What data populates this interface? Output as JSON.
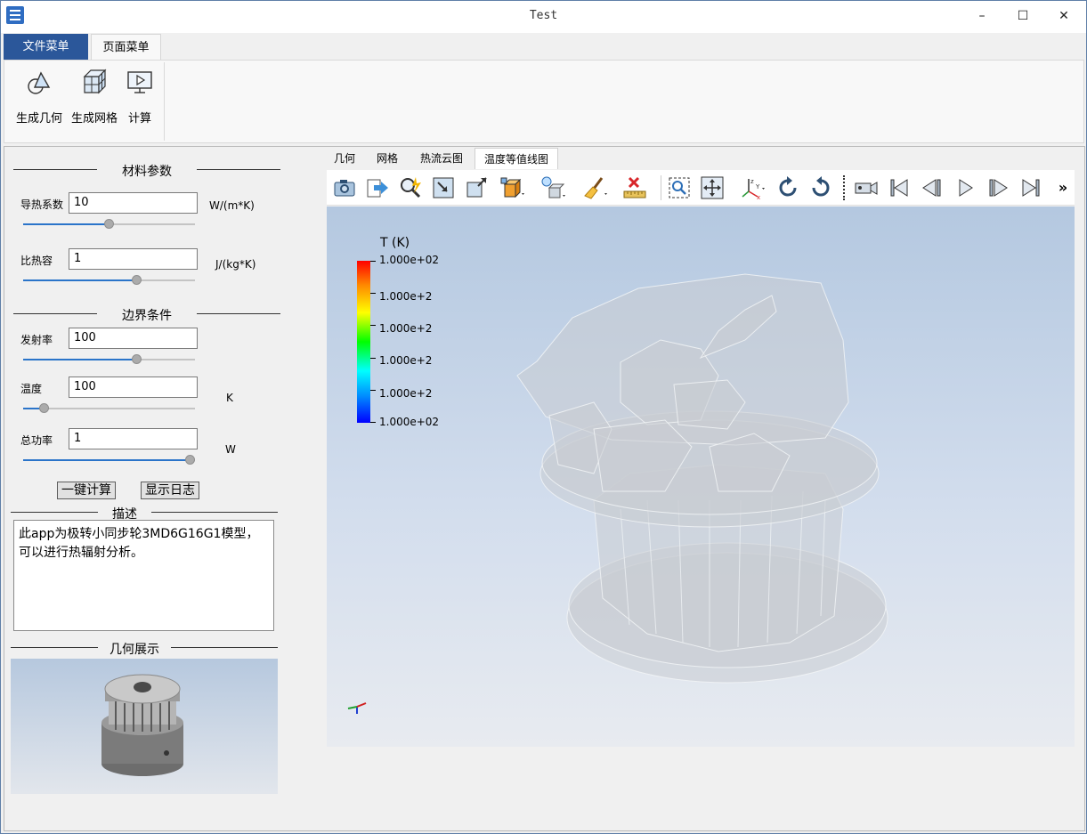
{
  "window": {
    "title": "Test",
    "minimize": "–",
    "maximize": "☐",
    "close": "✕"
  },
  "ribbon": {
    "tabs": [
      {
        "label": "文件菜单"
      },
      {
        "label": "页面菜单"
      }
    ],
    "buttons": [
      {
        "label": "生成几何"
      },
      {
        "label": "生成网格"
      },
      {
        "label": "计算"
      }
    ]
  },
  "panel": {
    "material_title": "材料参数",
    "boundary_title": "边界条件",
    "params": [
      {
        "label": "导热系数",
        "value": "10",
        "unit": "W/(m*K)",
        "slider": 0.5
      },
      {
        "label": "比热容",
        "value": "1",
        "unit": "J/(kg*K)",
        "slider": 0.67
      },
      {
        "label": "发射率",
        "value": "100",
        "unit": "",
        "slider": 0.67
      },
      {
        "label": "温度",
        "value": "100",
        "unit": "K",
        "slider": 0.1
      },
      {
        "label": "总功率",
        "value": "1",
        "unit": "W",
        "slider": 1.0
      }
    ],
    "calc_button": "一键计算",
    "log_button": "显示日志",
    "desc_title": "描述",
    "description": "此app为极转小同步轮3MD6G16G1模型，可以进行热辐射分析。",
    "geometry_title": "几何展示"
  },
  "viewer": {
    "tabs": [
      {
        "label": "几何"
      },
      {
        "label": "网格"
      },
      {
        "label": "热流云图"
      },
      {
        "label": "温度等值线图"
      }
    ],
    "toolbar_overflow": "»",
    "colorbar": {
      "title": "T (K)",
      "labels": [
        "1.000e+02",
        "1.000e+2",
        "1.000e+2",
        "1.000e+2",
        "1.000e+2",
        "1.000e+02"
      ]
    }
  }
}
